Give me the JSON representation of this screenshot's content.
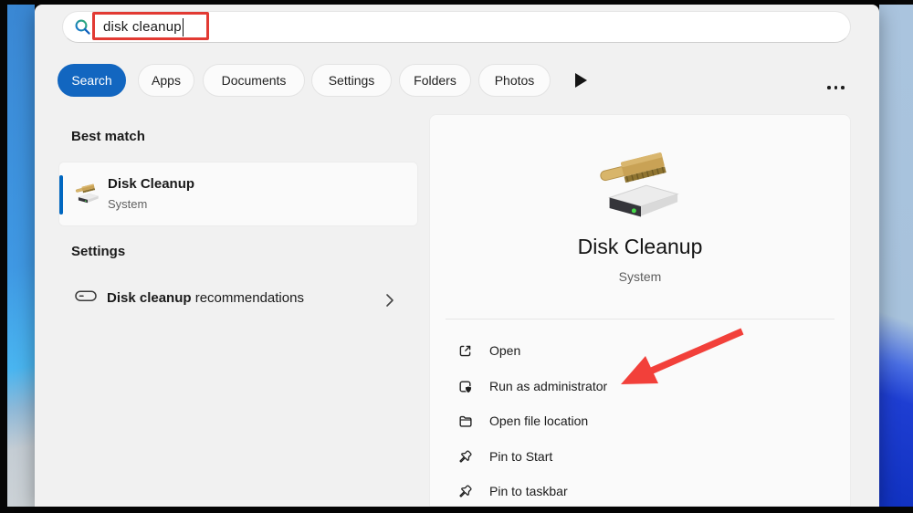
{
  "search": {
    "value": "disk cleanup"
  },
  "tabs": [
    {
      "label": "Search",
      "active": true
    },
    {
      "label": "Apps",
      "active": false
    },
    {
      "label": "Documents",
      "active": false
    },
    {
      "label": "Settings",
      "active": false
    },
    {
      "label": "Folders",
      "active": false
    },
    {
      "label": "Photos",
      "active": false
    }
  ],
  "left": {
    "best_match_heading": "Best match",
    "best_match": {
      "title": "Disk Cleanup",
      "subtitle": "System"
    },
    "settings_heading": "Settings",
    "settings_item": {
      "bold": "Disk cleanup",
      "rest": " recommendations"
    }
  },
  "right": {
    "title": "Disk Cleanup",
    "subtitle": "System",
    "actions": [
      {
        "label": "Open"
      },
      {
        "label": "Run as administrator"
      },
      {
        "label": "Open file location"
      },
      {
        "label": "Pin to Start"
      },
      {
        "label": "Pin to taskbar"
      }
    ]
  },
  "icons": {
    "search": "magnifier",
    "more_filters": "play-triangle",
    "more_options": "ellipsis",
    "best_match_app": "disk-drive-with-brush",
    "settings_item": "drive-outline",
    "settings_chevron": "chevron-right",
    "action_icons": [
      "open-external",
      "run-as-admin-shield",
      "folder",
      "pin",
      "pin"
    ]
  },
  "colors": {
    "accent_tab": "#1266c0",
    "accent_bar": "#0067c0",
    "annotation_box_red": "#e23a33",
    "annotation_arrow_red": "#f2403a"
  }
}
